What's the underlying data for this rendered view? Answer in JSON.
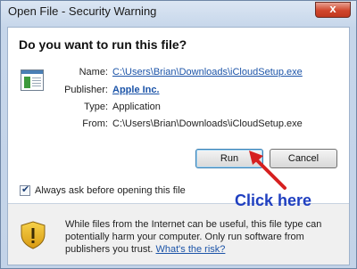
{
  "window": {
    "title": "Open File - Security Warning",
    "close_glyph": "x"
  },
  "dialog": {
    "heading": "Do you want to run this file?",
    "fields": {
      "name_label": "Name:",
      "name_value": "C:\\Users\\Brian\\Downloads\\iCloudSetup.exe",
      "publisher_label": "Publisher:",
      "publisher_value": "Apple Inc.",
      "type_label": "Type:",
      "type_value": "Application",
      "from_label": "From:",
      "from_value": "C:\\Users\\Brian\\Downloads\\iCloudSetup.exe"
    },
    "buttons": {
      "run": "Run",
      "cancel": "Cancel"
    },
    "checkbox": {
      "label": "Always ask before opening this file",
      "checked": true,
      "check_glyph": "✔"
    },
    "warning": {
      "text": "While files from the Internet can be useful, this file type can potentially harm your computer. Only run software from publishers you trust.",
      "link": "What's the risk?"
    }
  },
  "annotation": {
    "text": "Click here",
    "color": "#1f3fc0",
    "arrow_color": "#d62020"
  },
  "icons": [
    "close-icon",
    "file-icon",
    "shield-warning-icon",
    "arrow-icon"
  ]
}
